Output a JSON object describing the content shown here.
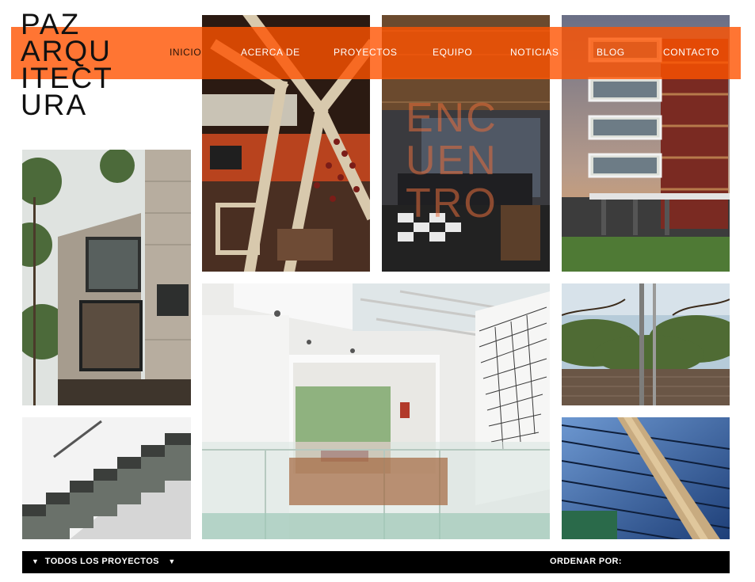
{
  "logo": {
    "lines": [
      "PAZ",
      "ARQU",
      "ITECT",
      "URA"
    ]
  },
  "nav": {
    "items": [
      "INICIO",
      "ACERCA DE",
      "PROYECTOS",
      "EQUIPO",
      "NOTICIAS",
      "BLOG",
      "CONTACTO"
    ],
    "accent": "#ff5200"
  },
  "gallery": {
    "overlay_text": [
      "ENC",
      "UEN",
      "TRO"
    ]
  },
  "bottom_bar": {
    "filter_label": "TODOS LOS PROYECTOS",
    "arrow_left": "▼",
    "arrow_right": "▼",
    "sort_label": "ORDENAR POR:"
  }
}
